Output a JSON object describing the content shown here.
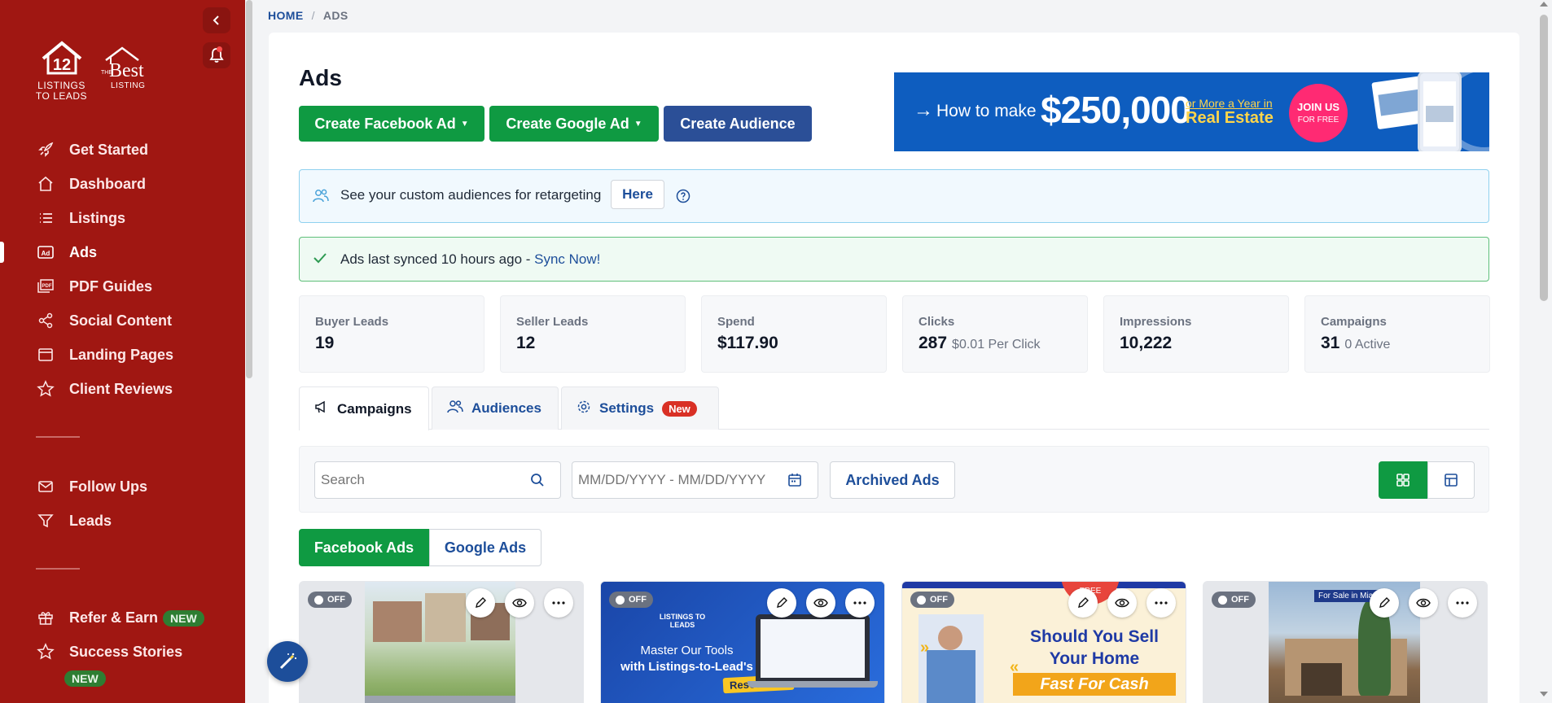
{
  "sidebar": {
    "logo_primary": {
      "line1": "LISTINGS",
      "line2": "TO LEADS"
    },
    "logo_secondary": {
      "the": "THE",
      "best": "Best",
      "listing": "LISTING"
    },
    "nav": [
      {
        "label": "Get Started",
        "icon": "rocket-icon"
      },
      {
        "label": "Dashboard",
        "icon": "home-icon"
      },
      {
        "label": "Listings",
        "icon": "list-icon"
      },
      {
        "label": "Ads",
        "icon": "ad-icon",
        "active": true
      },
      {
        "label": "PDF Guides",
        "icon": "pdf-icon"
      },
      {
        "label": "Social Content",
        "icon": "share-icon"
      },
      {
        "label": "Landing Pages",
        "icon": "window-icon"
      },
      {
        "label": "Client Reviews",
        "icon": "star-icon"
      }
    ],
    "nav2": [
      {
        "label": "Follow Ups",
        "icon": "mail-icon"
      },
      {
        "label": "Leads",
        "icon": "filter-icon"
      }
    ],
    "nav3": [
      {
        "label": "Refer & Earn",
        "icon": "gift-icon",
        "badge": "NEW"
      },
      {
        "label": "Success Stories",
        "icon": "star-icon",
        "badge": "NEW"
      }
    ]
  },
  "breadcrumb": {
    "home": "HOME",
    "separator": "/",
    "current": "ADS"
  },
  "page": {
    "title": "Ads"
  },
  "buttons": {
    "facebook": "Create Facebook Ad",
    "google": "Create Google Ad",
    "audience": "Create Audience"
  },
  "banner": {
    "how": "How to make",
    "amount": "$250,000",
    "or_more": "or More a Year in",
    "real_estate": "Real Estate",
    "join1": "JOIN US",
    "join2": "FOR FREE"
  },
  "info_alert": {
    "text": "See your custom audiences for retargeting",
    "button": "Here"
  },
  "sync_alert": {
    "text": "Ads last synced 10 hours ago - ",
    "link": "Sync Now!"
  },
  "stats": [
    {
      "label": "Buyer Leads",
      "value": "19",
      "sub": ""
    },
    {
      "label": "Seller Leads",
      "value": "12",
      "sub": ""
    },
    {
      "label": "Spend",
      "value": "$117.90",
      "sub": ""
    },
    {
      "label": "Clicks",
      "value": "287",
      "sub": "$0.01 Per Click"
    },
    {
      "label": "Impressions",
      "value": "10,222",
      "sub": ""
    },
    {
      "label": "Campaigns",
      "value": "31",
      "sub": "0 Active"
    }
  ],
  "tabs": [
    {
      "label": "Campaigns",
      "icon": "megaphone-icon",
      "active": true
    },
    {
      "label": "Audiences",
      "icon": "users-icon"
    },
    {
      "label": "Settings",
      "icon": "gear-icon",
      "badge": "New"
    }
  ],
  "toolbar": {
    "search_placeholder": "Search",
    "date_placeholder": "MM/DD/YYYY - MM/DD/YYYY",
    "archived": "Archived Ads"
  },
  "platform_tabs": {
    "facebook": "Facebook Ads",
    "google": "Google Ads"
  },
  "ads": [
    {
      "status": "OFF"
    },
    {
      "status": "OFF",
      "brand": "LISTINGS TO LEADS",
      "line1": "Master Our Tools",
      "line2": "with Listings-to-Lead's",
      "tag": "Resources!"
    },
    {
      "status": "OFF",
      "ribbon": "FREE",
      "line1": "Should You Sell",
      "line2": "Your Home",
      "line3": "Fast For Cash"
    },
    {
      "status": "OFF",
      "tag": "For Sale in Miami!"
    }
  ],
  "colors": {
    "sidebar": "#a01712",
    "primary_green": "#0f9a42",
    "primary_blue": "#2b4f97",
    "link_blue": "#1d4e9a"
  }
}
